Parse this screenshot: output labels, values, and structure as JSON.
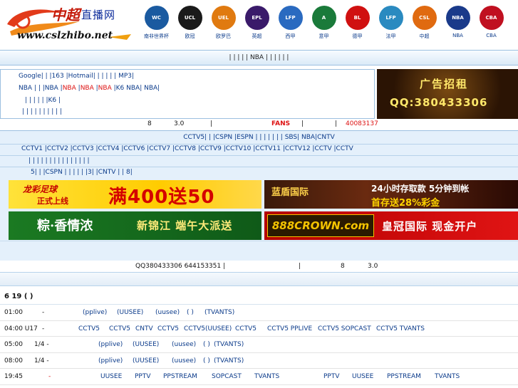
{
  "header": {
    "site_name": "直播网",
    "site_url": "www.cslzhibo.net",
    "leagues": [
      {
        "name": "南非世界杯",
        "icon": "world-cup-icon",
        "color": "#1a5aa0",
        "abbr": "WC"
      },
      {
        "name": "欧冠",
        "icon": "champions-league-icon",
        "color": "#1a1a1a",
        "abbr": "UCL"
      },
      {
        "name": "欧罗巴",
        "icon": "europa-league-icon",
        "color": "#e07a10",
        "abbr": "UEL"
      },
      {
        "name": "英超",
        "icon": "premier-league-icon",
        "color": "#3a1a6a",
        "abbr": "EPL"
      },
      {
        "name": "西甲",
        "icon": "lfp-icon",
        "color": "#2a6ac0",
        "abbr": "LFP"
      },
      {
        "name": "意甲",
        "icon": "lega-calcio-icon",
        "color": "#1a7a3a",
        "abbr": "A"
      },
      {
        "name": "德甲",
        "icon": "bundesliga-icon",
        "color": "#d01010",
        "abbr": "BL"
      },
      {
        "name": "法甲",
        "icon": "lfp-france-icon",
        "color": "#2a8ac0",
        "abbr": "LFP"
      },
      {
        "name": "中超",
        "icon": "csl-icon",
        "color": "#e06a10",
        "abbr": "CSL"
      },
      {
        "name": "NBA",
        "icon": "nba-icon",
        "color": "#1a3a8a",
        "abbr": "NBA"
      },
      {
        "name": "CBA",
        "icon": "cba-icon",
        "color": "#c01020",
        "abbr": "CBA"
      }
    ]
  },
  "navbar": {
    "text": "|   |      |      |      | NBA   |      |      |      |      |      |"
  },
  "linkbox": {
    "row1": "Google|  |  |163  |Hotmail|  |  |  |  |  |  MP3|",
    "row2a": "NBA  |   |   |NBA  |",
    "row2b": "NBA",
    "row2c": " |",
    "row2d": "NBA",
    "row2e": " |",
    "row2f": "NBA",
    "row2g": " |K6  NBA|     NBA|",
    "row3": "|      |     |     |     |     |K6     |",
    "row4": "|   |   |   |   |   |   |   |   |   |"
  },
  "ad_top": {
    "line1": "广告招租",
    "line2": "QQ:380433306"
  },
  "infoline": {
    "num": "8",
    "rate": "3.0",
    "pipe1": "|",
    "fans": "FANS",
    "pipe2": "|",
    "pipe3": "|",
    "phone": "40083137"
  },
  "tv": {
    "row1": "CCTV5|   |   |CSPN  |ESPN  |   |   |   |   |   |   | SBS|   NBA|CNTV",
    "row2": "CCTV1  |CCTV2  |CCTV3  |CCTV4  |CCTV6  |CCTV7  |CCTV8  |CCTV9  |CCTV10  |CCTV11  |CCTV12  |CCTV    |CCTV",
    "row3": "|   |   |   |   |   |   |   |   |   |   |   |   |   |   |",
    "row4": "5|   |   |CSPN  |   |   |   |   |   |3|   |CNTV  |   |  8|"
  },
  "banners": [
    {
      "a": "龙彩足球",
      "b": "正式上线",
      "c": "满400送50"
    },
    {
      "a": "蓝盾国际",
      "b": "24小时存取款 5分钟到帐",
      "c": "首存送28%彩金"
    },
    {
      "a": "粽·香情浓",
      "b": "新锦江 端午大派送"
    },
    {
      "a": "888CROWN.com",
      "b": "皇冠国际 现金开户"
    }
  ],
  "qqbar": {
    "qq": "QQ380433306  644153351 |",
    "pipe": "|",
    "num": "8",
    "rate": "3.0"
  },
  "schedule": {
    "date": "6  19       (   )",
    "rows": [
      {
        "time": "01:00",
        "league": "-",
        "channels": [
          "(pplive)",
          "(UUSEE)",
          "(uusee)",
          "(   )",
          "(TVANTS)"
        ]
      },
      {
        "time": "04:00  U17",
        "league": "-",
        "channels": [
          "CCTV5",
          "CCTV5",
          "CNTV",
          "CCTV5",
          "CCTV5(UUSEE)",
          "CCTV5",
          "CCTV5 PPLIVE",
          "CCTV5 SOPCAST",
          "CCTV5 TVANTS"
        ]
      },
      {
        "time": "05:00",
        "league": "1/4      -",
        "channels": [
          "(pplive)",
          "(UUSEE)",
          "(uusee)",
          "(   )",
          "(TVANTS)"
        ]
      },
      {
        "time": "08:00",
        "league": "1/4      -",
        "channels": [
          "(pplive)",
          "(UUSEE)",
          "(uusee)",
          "(   )",
          "(TVANTS)"
        ]
      },
      {
        "time": "19:45",
        "league": "-",
        "channels": [
          "UUSEE",
          "PPTV",
          "PPSTREAM",
          "SOPCAST",
          "TVANTS",
          "PPTV",
          "UUSEE",
          "PPSTREAM",
          "TVANTS"
        ]
      }
    ]
  }
}
